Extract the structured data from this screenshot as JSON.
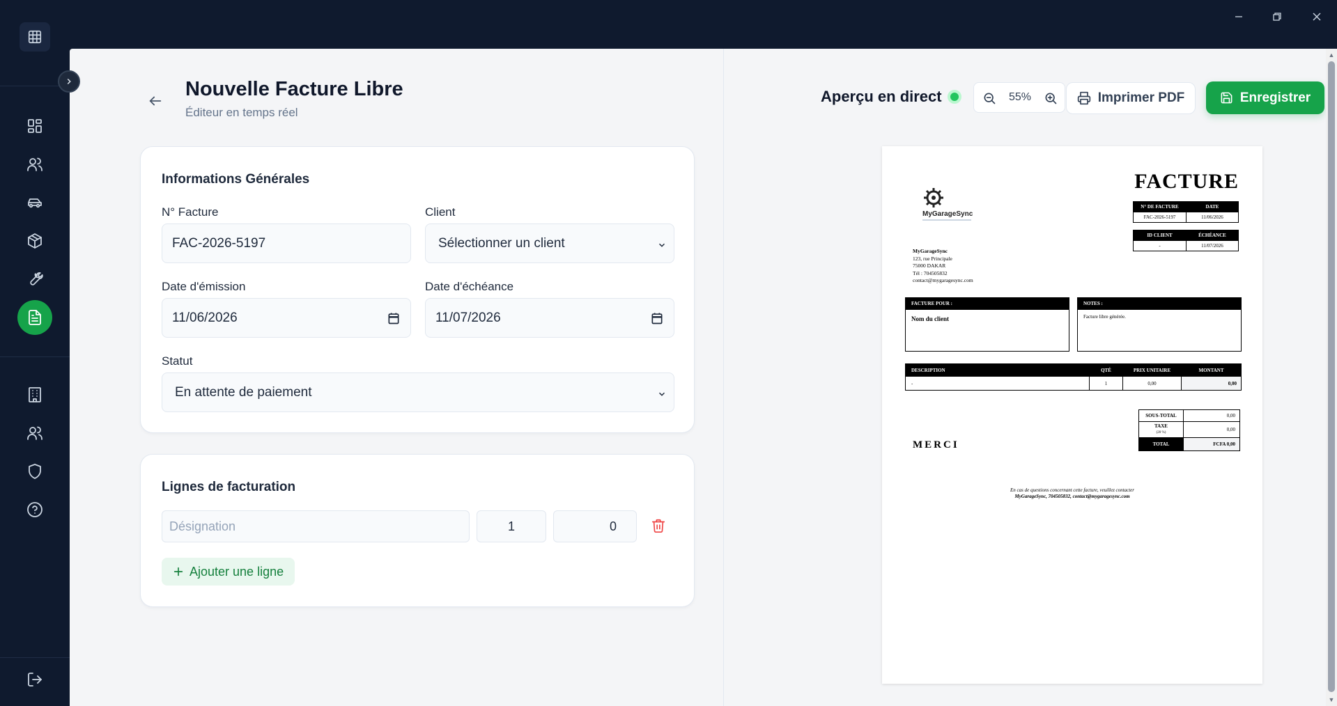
{
  "window": {
    "minimize": "—",
    "restore": "❐",
    "close": "✕"
  },
  "sidebar": {
    "items": [
      {
        "name": "dashboard"
      },
      {
        "name": "clients"
      },
      {
        "name": "vehicles"
      },
      {
        "name": "inventory"
      },
      {
        "name": "repairs"
      },
      {
        "name": "invoices",
        "active": true
      },
      {
        "name": "company"
      },
      {
        "name": "team"
      },
      {
        "name": "security"
      },
      {
        "name": "help"
      },
      {
        "name": "logout"
      }
    ]
  },
  "header": {
    "title": "Nouvelle Facture Libre",
    "subtitle": "Éditeur en temps réel"
  },
  "general": {
    "title": "Informations Générales",
    "invoice_no_label": "N° Facture",
    "invoice_no_value": "FAC-2026-5197",
    "client_label": "Client",
    "client_value": "Sélectionner un client",
    "issue_date_label": "Date d'émission",
    "issue_date_value": "11/06/2026",
    "due_date_label": "Date d'échéance",
    "due_date_value": "11/07/2026",
    "status_label": "Statut",
    "status_value": "En attente de paiement"
  },
  "lines": {
    "title": "Lignes de facturation",
    "designation_placeholder": "Désignation",
    "qty_value": "1",
    "price_value": "0",
    "add_label": "Ajouter une ligne"
  },
  "preview": {
    "live_label": "Aperçu en direct",
    "zoom": "55%",
    "print_label": "Imprimer PDF",
    "save_label": "Enregistrer"
  },
  "invoice": {
    "brand": "MyGarageSync",
    "title": "FACTURE",
    "h_number": "N° DE FACTURE",
    "h_date": "DATE",
    "number": "FAC-2026-5197",
    "date": "11/06/2026",
    "h_client_id": "ID CLIENT",
    "h_due": "ÉCHÉANCE",
    "client_id": "-",
    "due": "11/07/2026",
    "company_name": "MyGarageSync",
    "address1": "123, rue Principale",
    "address2": "75000 DAKAR",
    "phone": "Tél : 704505832",
    "email": "contact@mygaragesync.com",
    "bill_to_head": "FACTURE POUR :",
    "bill_to": "Nom du client",
    "notes_head": "NOTES :",
    "notes": "Facture libre générée.",
    "col_desc": "DESCRIPTION",
    "col_qty": "QTÉ",
    "col_unit": "PRIX UNITAIRE",
    "col_amount": "MONTANT",
    "row_desc": "-",
    "row_qty": "1",
    "row_unit": "0,00",
    "row_amount": "0,00",
    "subtotal_label": "SOUS-TOTAL",
    "subtotal": "0,00",
    "tax_label": "TAXE",
    "tax_rate": "(20 %)",
    "tax": "0,00",
    "total_label": "TOTAL",
    "total": "FCFA 0,00",
    "thanks": "MERCI",
    "footer1": "En cas de questions concernant cette facture, veuillez contacter",
    "footer2": "MyGarageSync, 704505832, contact@mygaragesync.com"
  },
  "colors": {
    "accent": "#16a34a",
    "sidebar_bg": "#0f1a2e",
    "danger": "#ef4444"
  }
}
